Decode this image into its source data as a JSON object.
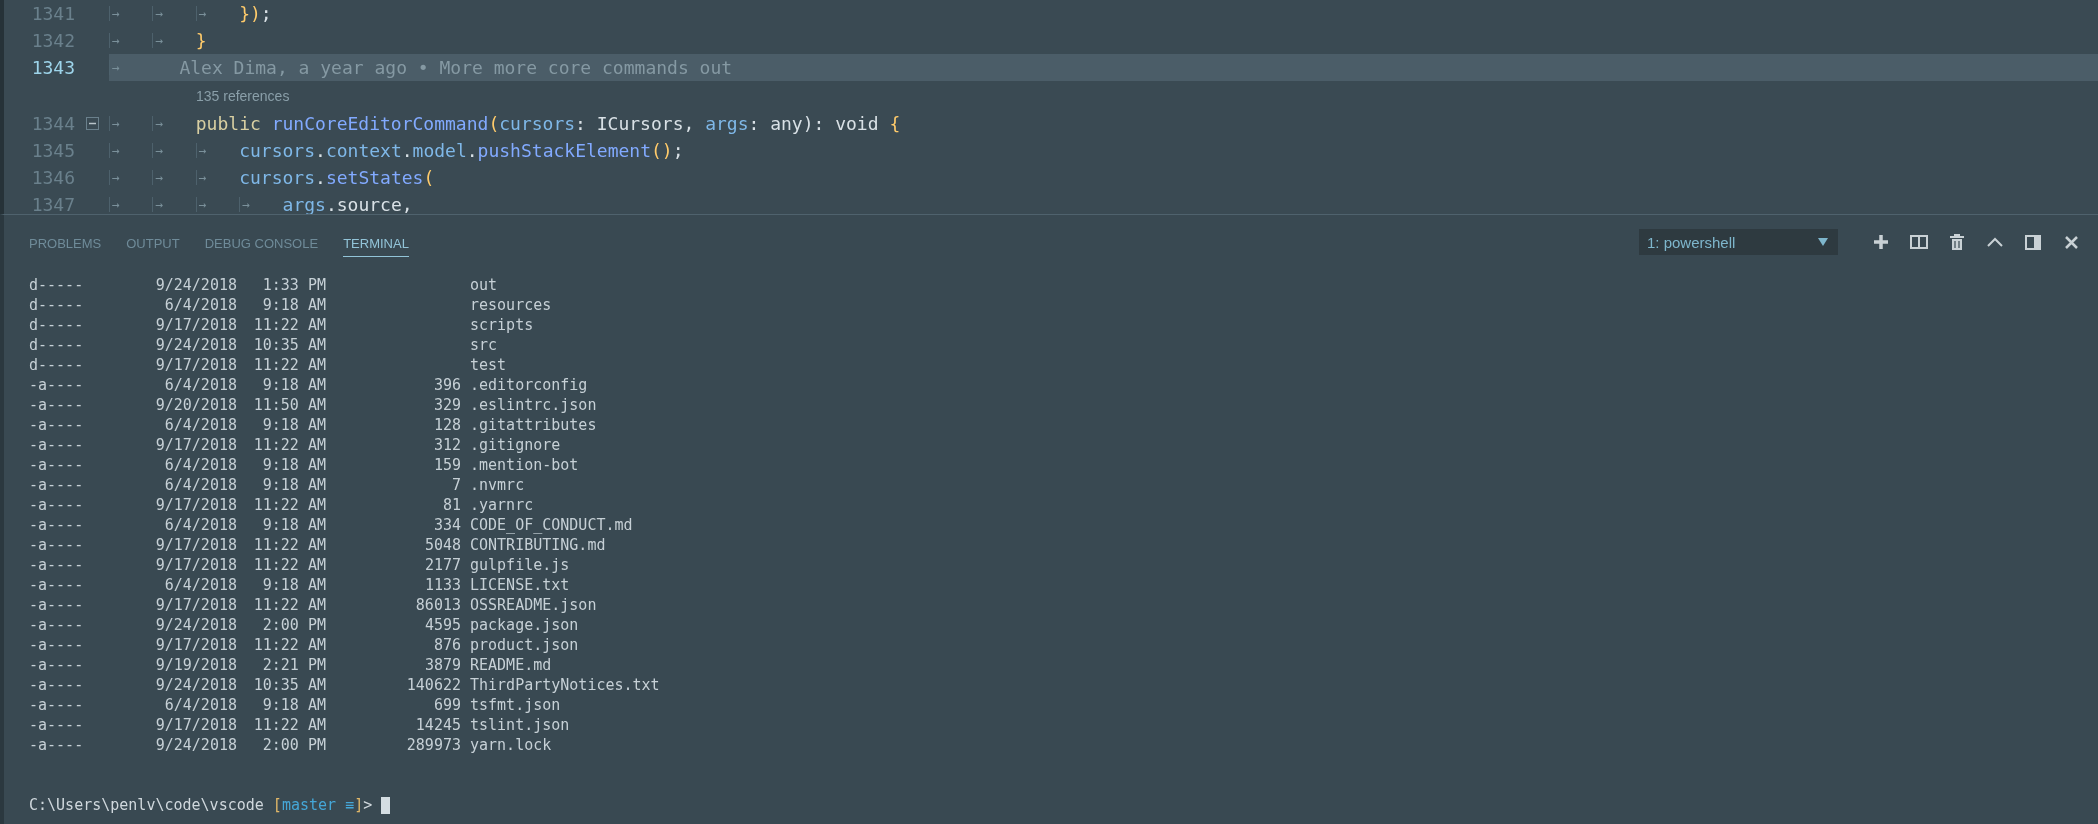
{
  "editor": {
    "lines": [
      {
        "number": "1341",
        "current": false,
        "foldable": false,
        "tokens": [
          {
            "kind": "tab",
            "text": "→"
          },
          {
            "kind": "tab",
            "text": "→"
          },
          {
            "kind": "tab",
            "text": "→"
          },
          {
            "kind": "punct",
            "text": "})"
          },
          {
            "kind": "plain",
            "text": ";"
          }
        ]
      },
      {
        "number": "1342",
        "current": false,
        "foldable": false,
        "tokens": [
          {
            "kind": "tab",
            "text": "→"
          },
          {
            "kind": "tab",
            "text": "→"
          },
          {
            "kind": "punct",
            "text": "}"
          }
        ]
      },
      {
        "number": "1343",
        "current": true,
        "foldable": false,
        "tokens": [
          {
            "kind": "tab",
            "text": "→"
          },
          {
            "kind": "blame",
            "text": "Alex Dima, a year ago • More more core commands out"
          }
        ]
      },
      {
        "kind": "codelens",
        "text": "135 references"
      },
      {
        "number": "1344",
        "current": false,
        "foldable": true,
        "tokens": [
          {
            "kind": "tab",
            "text": "→"
          },
          {
            "kind": "tab",
            "text": "→"
          },
          {
            "kind": "keyword",
            "text": "public "
          },
          {
            "kind": "function",
            "text": "runCoreEditorCommand"
          },
          {
            "kind": "punct",
            "text": "("
          },
          {
            "kind": "var",
            "text": "cursors"
          },
          {
            "kind": "plain",
            "text": ": ICursors, "
          },
          {
            "kind": "var",
            "text": "args"
          },
          {
            "kind": "plain",
            "text": ": any): void "
          },
          {
            "kind": "punct",
            "text": "{"
          }
        ]
      },
      {
        "number": "1345",
        "current": false,
        "foldable": false,
        "tokens": [
          {
            "kind": "tab",
            "text": "→"
          },
          {
            "kind": "tab",
            "text": "→"
          },
          {
            "kind": "tab",
            "text": "→"
          },
          {
            "kind": "var",
            "text": "cursors"
          },
          {
            "kind": "plain",
            "text": "."
          },
          {
            "kind": "var",
            "text": "context"
          },
          {
            "kind": "plain",
            "text": "."
          },
          {
            "kind": "var",
            "text": "model"
          },
          {
            "kind": "plain",
            "text": "."
          },
          {
            "kind": "function",
            "text": "pushStackElement"
          },
          {
            "kind": "punct",
            "text": "()"
          },
          {
            "kind": "plain",
            "text": ";"
          }
        ]
      },
      {
        "number": "1346",
        "current": false,
        "foldable": false,
        "tokens": [
          {
            "kind": "tab",
            "text": "→"
          },
          {
            "kind": "tab",
            "text": "→"
          },
          {
            "kind": "tab",
            "text": "→"
          },
          {
            "kind": "var",
            "text": "cursors"
          },
          {
            "kind": "plain",
            "text": "."
          },
          {
            "kind": "function",
            "text": "setStates"
          },
          {
            "kind": "punct",
            "text": "("
          }
        ]
      },
      {
        "number": "1347",
        "current": false,
        "foldable": false,
        "tokens": [
          {
            "kind": "tab",
            "text": "→"
          },
          {
            "kind": "tab",
            "text": "→"
          },
          {
            "kind": "tab",
            "text": "→"
          },
          {
            "kind": "tab",
            "text": "→"
          },
          {
            "kind": "var",
            "text": "args"
          },
          {
            "kind": "plain",
            "text": ".source,"
          }
        ]
      }
    ]
  },
  "panel": {
    "tabs": [
      {
        "label": "PROBLEMS",
        "selected": false
      },
      {
        "label": "OUTPUT",
        "selected": false
      },
      {
        "label": "DEBUG CONSOLE",
        "selected": false
      },
      {
        "label": "TERMINAL",
        "selected": true
      }
    ],
    "terminal_select": {
      "value": "1: powershell"
    },
    "terminal": {
      "rows": [
        {
          "mode": "d-----",
          "date": "9/24/2018",
          "time": "1:33 PM",
          "name": "out"
        },
        {
          "mode": "d-----",
          "date": "6/4/2018",
          "time": "9:18 AM",
          "name": "resources"
        },
        {
          "mode": "d-----",
          "date": "9/17/2018",
          "time": "11:22 AM",
          "name": "scripts"
        },
        {
          "mode": "d-----",
          "date": "9/24/2018",
          "time": "10:35 AM",
          "name": "src"
        },
        {
          "mode": "d-----",
          "date": "9/17/2018",
          "time": "11:22 AM",
          "name": "test"
        },
        {
          "mode": "-a----",
          "date": "6/4/2018",
          "time": "9:18 AM",
          "size": "396",
          "name": ".editorconfig"
        },
        {
          "mode": "-a----",
          "date": "9/20/2018",
          "time": "11:50 AM",
          "size": "329",
          "name": ".eslintrc.json"
        },
        {
          "mode": "-a----",
          "date": "6/4/2018",
          "time": "9:18 AM",
          "size": "128",
          "name": ".gitattributes"
        },
        {
          "mode": "-a----",
          "date": "9/17/2018",
          "time": "11:22 AM",
          "size": "312",
          "name": ".gitignore"
        },
        {
          "mode": "-a----",
          "date": "6/4/2018",
          "time": "9:18 AM",
          "size": "159",
          "name": ".mention-bot"
        },
        {
          "mode": "-a----",
          "date": "6/4/2018",
          "time": "9:18 AM",
          "size": "7",
          "name": ".nvmrc"
        },
        {
          "mode": "-a----",
          "date": "9/17/2018",
          "time": "11:22 AM",
          "size": "81",
          "name": ".yarnrc"
        },
        {
          "mode": "-a----",
          "date": "6/4/2018",
          "time": "9:18 AM",
          "size": "334",
          "name": "CODE_OF_CONDUCT.md"
        },
        {
          "mode": "-a----",
          "date": "9/17/2018",
          "time": "11:22 AM",
          "size": "5048",
          "name": "CONTRIBUTING.md"
        },
        {
          "mode": "-a----",
          "date": "9/17/2018",
          "time": "11:22 AM",
          "size": "2177",
          "name": "gulpfile.js"
        },
        {
          "mode": "-a----",
          "date": "6/4/2018",
          "time": "9:18 AM",
          "size": "1133",
          "name": "LICENSE.txt"
        },
        {
          "mode": "-a----",
          "date": "9/17/2018",
          "time": "11:22 AM",
          "size": "86013",
          "name": "OSSREADME.json"
        },
        {
          "mode": "-a----",
          "date": "9/24/2018",
          "time": "2:00 PM",
          "size": "4595",
          "name": "package.json"
        },
        {
          "mode": "-a----",
          "date": "9/17/2018",
          "time": "11:22 AM",
          "size": "876",
          "name": "product.json"
        },
        {
          "mode": "-a----",
          "date": "9/19/2018",
          "time": "2:21 PM",
          "size": "3879",
          "name": "README.md"
        },
        {
          "mode": "-a----",
          "date": "9/24/2018",
          "time": "10:35 AM",
          "size": "140622",
          "name": "ThirdPartyNotices.txt"
        },
        {
          "mode": "-a----",
          "date": "6/4/2018",
          "time": "9:18 AM",
          "size": "699",
          "name": "tsfmt.json"
        },
        {
          "mode": "-a----",
          "date": "9/17/2018",
          "time": "11:22 AM",
          "size": "14245",
          "name": "tslint.json"
        },
        {
          "mode": "-a----",
          "date": "9/24/2018",
          "time": "2:00 PM",
          "size": "289973",
          "name": "yarn.lock"
        }
      ],
      "prompt": [
        {
          "kind": "path",
          "text": "C:\\Users\\penlv\\code\\vscode "
        },
        {
          "kind": "bracket",
          "text": "["
        },
        {
          "kind": "branch",
          "text": "master ≡"
        },
        {
          "kind": "bracket",
          "text": "]"
        },
        {
          "kind": "path",
          "text": "> "
        }
      ]
    }
  }
}
